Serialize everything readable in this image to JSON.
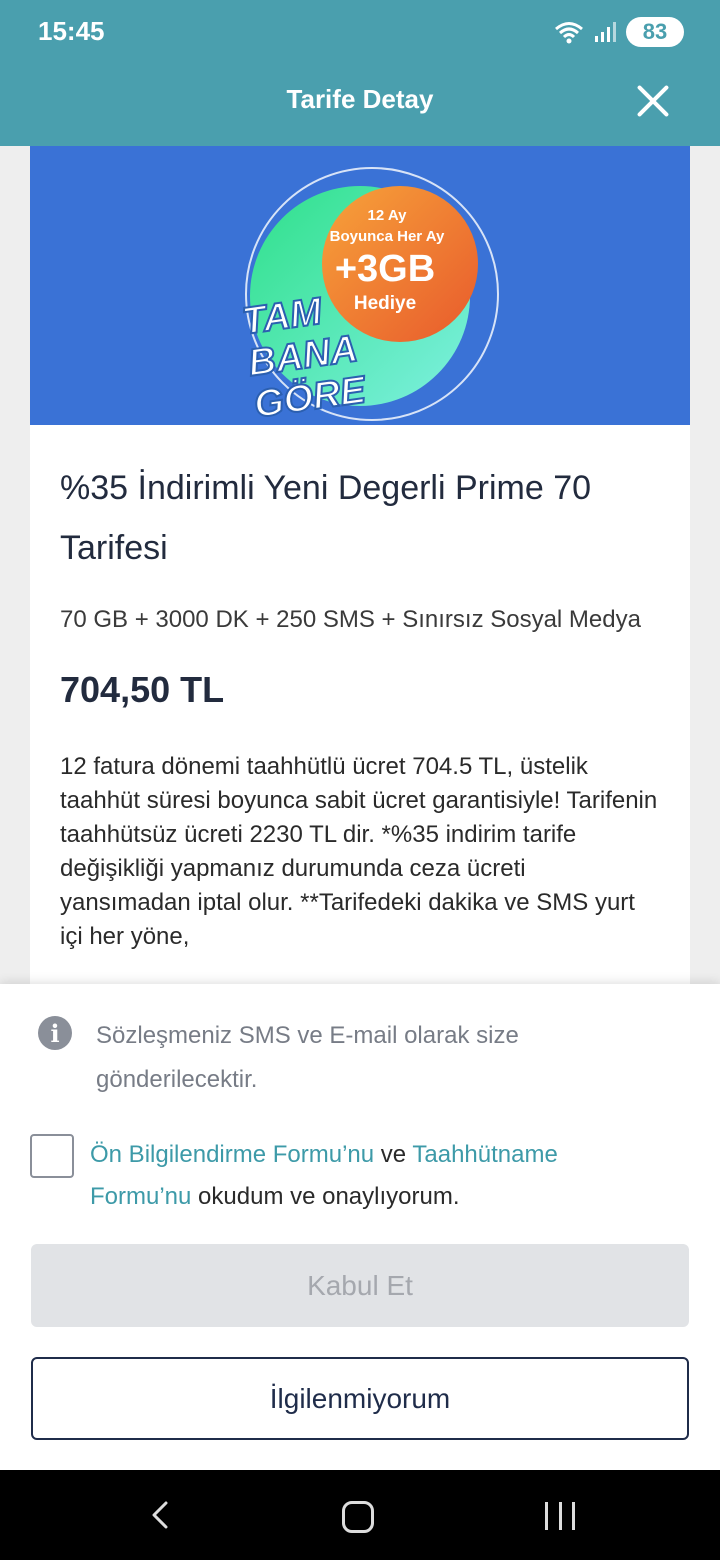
{
  "status_bar": {
    "time": "15:45",
    "battery": "83"
  },
  "header": {
    "title": "Tarife Detay"
  },
  "banner": {
    "line1": "12 Ay",
    "line2": "Boyunca Her Ay",
    "line3": "+3GB",
    "line4": "Hediye",
    "logo_words": [
      "TAM",
      "BANA",
      "GÖRE"
    ]
  },
  "tariff": {
    "title": "%35 İndirimli Yeni Degerli Prime 70 Tarifesi",
    "description": "70 GB + 3000 DK + 250 SMS + Sınırsız Sosyal Medya",
    "price": "704,50 TL",
    "details": "12 fatura dönemi taahhütlü ücret 704.5 TL, üstelik taahhüt süresi boyunca sabit ücret garantisiyle! Tarifenin taahhütsüz ücreti 2230 TL dir. *%35 indirim tarife değişikliği yapmanız durumunda ceza ücreti yansımadan iptal olur. **Tarifedeki dakika ve SMS yurt içi her yöne,"
  },
  "sheet": {
    "info_text": "Sözleşmeniz SMS ve E-mail olarak size gönderilecektir.",
    "consent": {
      "link1": "Ön Bilgilendirme Formu’nu",
      "connector": "ve",
      "link2": "Taahhütname Formu’nu",
      "suffix": "okudum ve onaylıyorum."
    },
    "accept_label": "Kabul Et",
    "decline_label": "İlgilenmiyorum"
  },
  "colors": {
    "header_bg": "#4a9fae",
    "banner_bg": "#3a72d6",
    "link": "#3d9aa8",
    "primary_dark": "#1f2c4a"
  }
}
